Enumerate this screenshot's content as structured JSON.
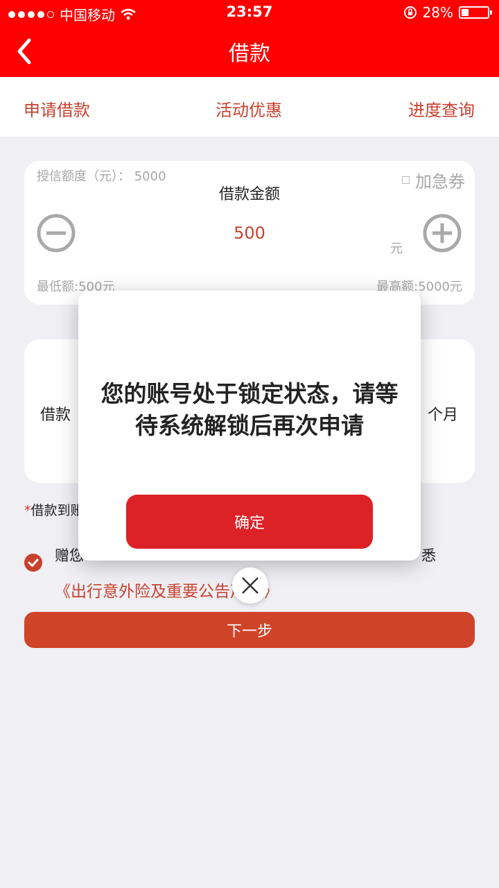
{
  "status_bar": {
    "carrier": "中国移动",
    "time": "23:57",
    "battery": "28%",
    "battery_level": 0.28
  },
  "navbar": {
    "title": "借款"
  },
  "tabs": [
    {
      "label": "申请借款",
      "active": true
    },
    {
      "label": "活动优惠",
      "active": false
    },
    {
      "label": "进度查询",
      "active": false
    }
  ],
  "loan_card": {
    "credit_limit_label": "授信额度（元）：",
    "credit_limit_value": "5000",
    "urgent_coupon_label": "加急券",
    "amount_title": "借款金额",
    "amount_value": "500",
    "unit": "元",
    "min_label": "最低额:500元",
    "max_label": "最高额:5000元"
  },
  "term_card": {
    "left_label": "借款",
    "right_label": "个月"
  },
  "notice": {
    "asterisk": "*",
    "text": "借款到账"
  },
  "agreement": {
    "text_left": "赠您",
    "text_right": "悉",
    "link": "《出行意外险及重要公告声明》"
  },
  "next_button": "下一步",
  "dialog": {
    "message": "您的账号处于锁定状态，请等待系统解锁后再次申请",
    "confirm": "确定"
  },
  "colors": {
    "brand_red": "#ff0000",
    "accent": "#c8412f",
    "confirm_red": "#dc2226"
  }
}
